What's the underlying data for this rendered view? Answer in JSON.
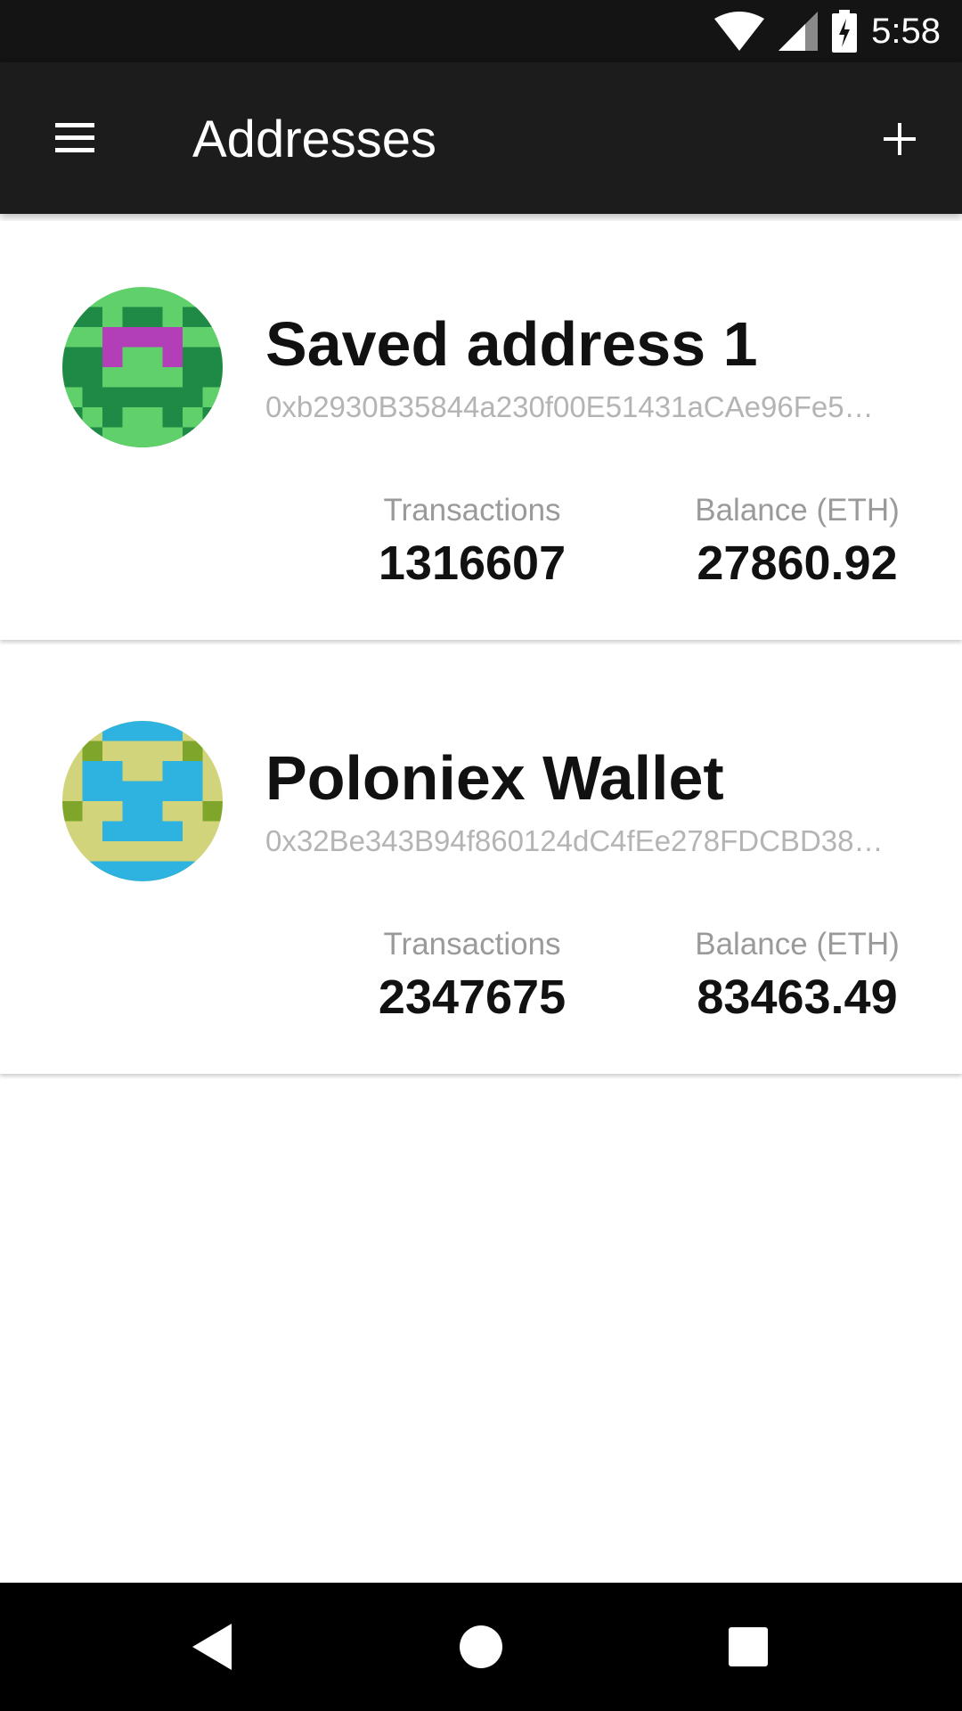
{
  "status_bar": {
    "time": "5:58",
    "icons": [
      "wifi-icon",
      "signal-icon",
      "battery-charging-icon"
    ]
  },
  "app_bar": {
    "title": "Addresses",
    "menu_icon": "hamburger-menu-icon",
    "add_icon": "plus-icon"
  },
  "addresses": [
    {
      "name": "Saved address 1",
      "address": "0xb2930B35844a230f00E51431aCAe96Fe5…",
      "transactions_label": "Transactions",
      "transactions": "1316607",
      "balance_label": "Balance (ETH)",
      "balance": "27860.92",
      "avatar_colors": [
        "#5fd06a",
        "#1f8a45",
        "#b23fb8"
      ]
    },
    {
      "name": "Poloniex Wallet",
      "address": "0x32Be343B94f860124dC4fEe278FDCBD38…",
      "transactions_label": "Transactions",
      "transactions": "2347675",
      "balance_label": "Balance (ETH)",
      "balance": "83463.49",
      "avatar_colors": [
        "#d1d47a",
        "#2eb2e0",
        "#7fa52a"
      ]
    }
  ],
  "nav_bar": {
    "icons": [
      "back-icon",
      "home-icon",
      "recents-icon"
    ]
  }
}
